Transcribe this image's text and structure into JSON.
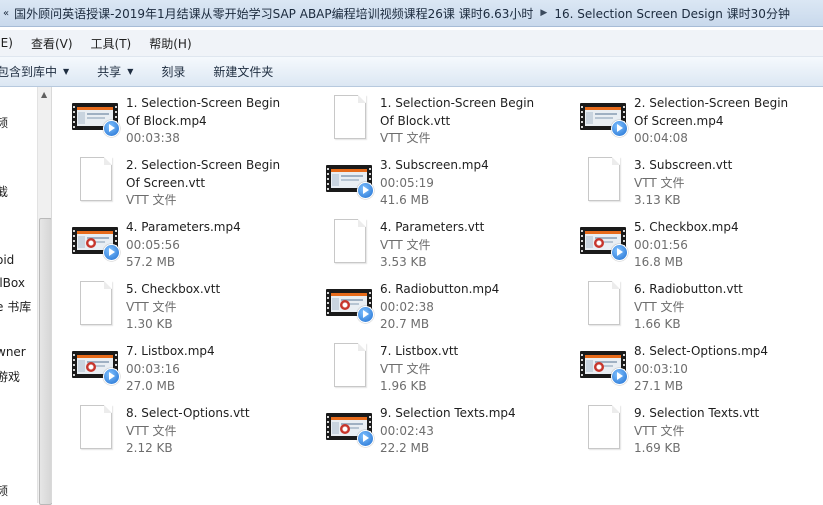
{
  "addressbar": {
    "crumbs": [
      "国外顾问英语授课-2019年1月结课从零开始学习SAP ABAP编程培训视频课程26课 课时6.63小时",
      "16. Selection Screen Design 课时30分钟"
    ]
  },
  "menubar": [
    "(E)",
    "查看(V)",
    "工具(T)",
    "帮助(H)"
  ],
  "toolbar": {
    "include_library": "包含到库中",
    "share": "共享",
    "burn": "刻录",
    "new_folder": "新建文件夹"
  },
  "nav": [
    "频",
    "截",
    "oid",
    "llBox",
    "e 书库",
    "wner",
    "游戏",
    "频"
  ],
  "files": [
    {
      "name": "1. Selection-Screen Begin Of Block.mp4",
      "meta1": "00:03:38",
      "meta2": "",
      "type": "video",
      "icon": "video-icon",
      "variant": "plain"
    },
    {
      "name": "1. Selection-Screen Begin Of Block.vtt",
      "meta1": "VTT 文件",
      "meta2": "",
      "type": "doc",
      "icon": "document-icon"
    },
    {
      "name": "2. Selection-Screen Begin Of Screen.mp4",
      "meta1": "00:04:08",
      "meta2": "",
      "type": "video",
      "icon": "video-icon",
      "variant": "plain"
    },
    {
      "name": "2. Selection-Screen Begin Of Screen.vtt",
      "meta1": "VTT 文件",
      "meta2": "",
      "type": "doc",
      "icon": "document-icon"
    },
    {
      "name": "3. Subscreen.mp4",
      "meta1": "00:05:19",
      "meta2": "41.6 MB",
      "type": "video",
      "icon": "video-icon",
      "variant": "plain"
    },
    {
      "name": "3. Subscreen.vtt",
      "meta1": "VTT 文件",
      "meta2": "3.13 KB",
      "type": "doc",
      "icon": "document-icon"
    },
    {
      "name": "4. Parameters.mp4",
      "meta1": "00:05:56",
      "meta2": "57.2 MB",
      "type": "video",
      "icon": "video-icon",
      "variant": "gear"
    },
    {
      "name": "4. Parameters.vtt",
      "meta1": "VTT 文件",
      "meta2": "3.53 KB",
      "type": "doc",
      "icon": "document-icon"
    },
    {
      "name": "5. Checkbox.mp4",
      "meta1": "00:01:56",
      "meta2": "16.8 MB",
      "type": "video",
      "icon": "video-icon",
      "variant": "gear"
    },
    {
      "name": "5. Checkbox.vtt",
      "meta1": "VTT 文件",
      "meta2": "1.30 KB",
      "type": "doc",
      "icon": "document-icon"
    },
    {
      "name": "6. Radiobutton.mp4",
      "meta1": "00:02:38",
      "meta2": "20.7 MB",
      "type": "video",
      "icon": "video-icon",
      "variant": "gear"
    },
    {
      "name": "6. Radiobutton.vtt",
      "meta1": "VTT 文件",
      "meta2": "1.66 KB",
      "type": "doc",
      "icon": "document-icon"
    },
    {
      "name": "7. Listbox.mp4",
      "meta1": "00:03:16",
      "meta2": "27.0 MB",
      "type": "video",
      "icon": "video-icon",
      "variant": "gear"
    },
    {
      "name": "7. Listbox.vtt",
      "meta1": "VTT 文件",
      "meta2": "1.96 KB",
      "type": "doc",
      "icon": "document-icon"
    },
    {
      "name": "8. Select-Options.mp4",
      "meta1": "00:03:10",
      "meta2": "27.1 MB",
      "type": "video",
      "icon": "video-icon",
      "variant": "gear"
    },
    {
      "name": "8. Select-Options.vtt",
      "meta1": "VTT 文件",
      "meta2": "2.12 KB",
      "type": "doc",
      "icon": "document-icon"
    },
    {
      "name": "9. Selection Texts.mp4",
      "meta1": "00:02:43",
      "meta2": "22.2 MB",
      "type": "video",
      "icon": "video-icon",
      "variant": "gear"
    },
    {
      "name": "9. Selection Texts.vtt",
      "meta1": "VTT 文件",
      "meta2": "1.69 KB",
      "type": "doc",
      "icon": "document-icon"
    }
  ]
}
